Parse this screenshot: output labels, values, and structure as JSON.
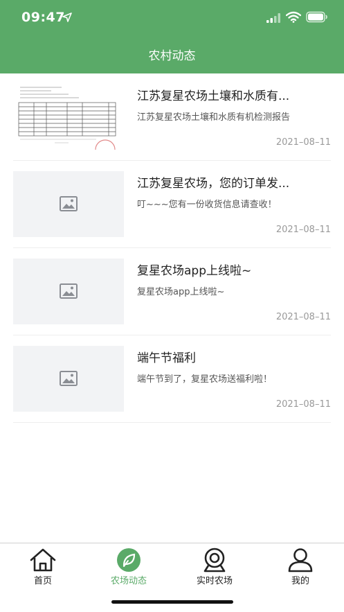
{
  "status_bar": {
    "time": "09:47"
  },
  "header": {
    "title": "农村动态"
  },
  "news": [
    {
      "title": "江苏复星农场土壤和水质有...",
      "summary": "江苏复星农场土壤和水质有机检测报告",
      "date": "2021–08–11",
      "thumb": "document-thumbnail"
    },
    {
      "title": "江苏复星农场，您的订单发...",
      "summary": "叮~~~您有一份收货信息请查收！",
      "date": "2021–08–11",
      "thumb": "image-placeholder-icon"
    },
    {
      "title": "复星农场app上线啦~",
      "summary": "复星农场app上线啦~",
      "date": "2021–08–11",
      "thumb": "image-placeholder-icon"
    },
    {
      "title": "端午节福利",
      "summary": "端午节到了，复星农场送福利啦！",
      "date": "2021–08–11",
      "thumb": "image-placeholder-icon"
    }
  ],
  "tabs": [
    {
      "label": "首页",
      "icon": "home-icon",
      "active": false
    },
    {
      "label": "农场动态",
      "icon": "leaf-icon",
      "active": true
    },
    {
      "label": "实时农场",
      "icon": "camera-icon",
      "active": false
    },
    {
      "label": "我的",
      "icon": "user-icon",
      "active": false
    }
  ],
  "colors": {
    "primary": "#5aaa68",
    "text": "#222222",
    "muted": "#999999",
    "placeholder_bg": "#f2f3f5"
  }
}
